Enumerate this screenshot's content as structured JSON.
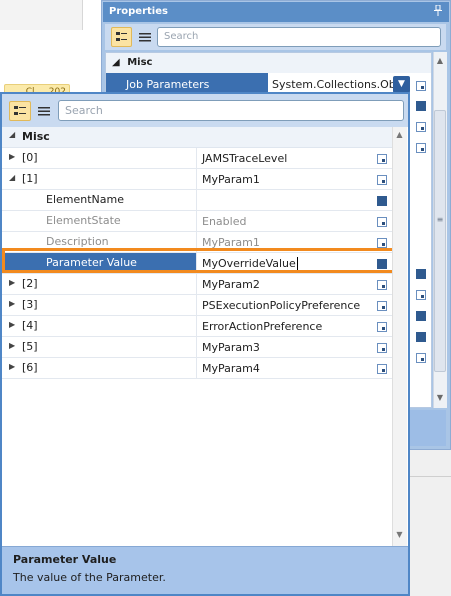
{
  "back_panel": {
    "title": "Properties",
    "pin_icon": "pin-icon",
    "search_placeholder": "Search",
    "category": "Misc",
    "selected_property": "Job Parameters",
    "selected_value": "System.Collections.Obje",
    "dropdown_glyph": "▼",
    "partial_chip_text": "Cl.....202"
  },
  "editor": {
    "search_placeholder": "Search",
    "category": "Misc",
    "rows": [
      {
        "name": "[0]",
        "value": "JAMSTraceLevel"
      },
      {
        "name": "[1]",
        "value": "MyParam1"
      },
      {
        "name": "ElementName",
        "value": ""
      },
      {
        "name": "ElementState",
        "value": "Enabled"
      },
      {
        "name": "Description",
        "value": "MyParam1"
      },
      {
        "name": "Parameter Value",
        "value": "MyOverrideValue"
      },
      {
        "name": "[2]",
        "value": "MyParam2"
      },
      {
        "name": "[3]",
        "value": "PSExecutionPolicyPreference"
      },
      {
        "name": "[4]",
        "value": "ErrorActionPreference"
      },
      {
        "name": "[5]",
        "value": "MyParam3"
      },
      {
        "name": "[6]",
        "value": "MyParam4"
      }
    ],
    "description_title": "Parameter Value",
    "description_text": "The value of the Parameter."
  },
  "colors": {
    "accent": "#3b6fb0",
    "highlight": "#f28a1e",
    "title_bar": "#5b8ec7"
  }
}
